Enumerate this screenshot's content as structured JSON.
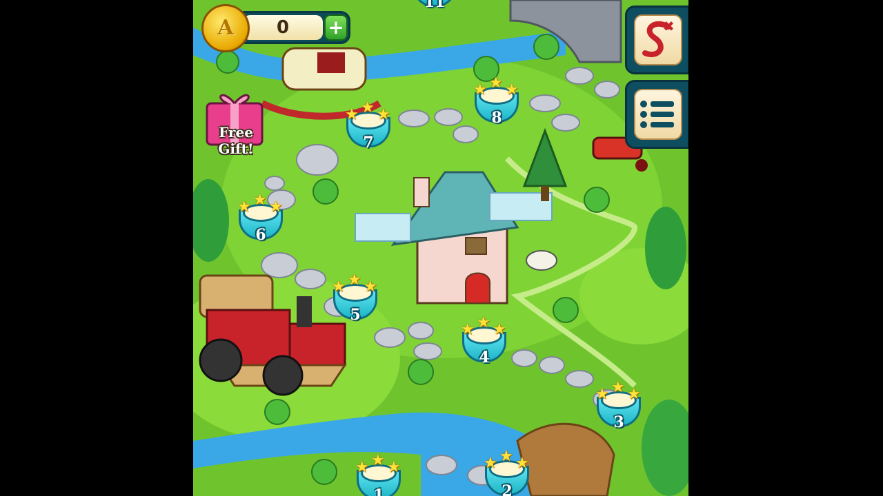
{
  "currency": {
    "letter": "A",
    "amount": "0",
    "add_label": "+"
  },
  "free_gift": {
    "line1": "Free",
    "line2": "Gift!"
  },
  "side_buttons": {
    "top_icon": "s-path-icon",
    "bottom_icon": "list-menu-icon"
  },
  "levels": [
    {
      "number": "1",
      "stars": 3
    },
    {
      "number": "2",
      "stars": 3
    },
    {
      "number": "3",
      "stars": 3
    },
    {
      "number": "4",
      "stars": 3
    },
    {
      "number": "5",
      "stars": 3
    },
    {
      "number": "6",
      "stars": 3
    },
    {
      "number": "7",
      "stars": 3
    },
    {
      "number": "8",
      "stars": 3
    },
    {
      "number": "11",
      "stars": 0
    }
  ],
  "colors": {
    "grass": "#6fc42e",
    "river": "#3aa7e6",
    "node": "#1db6c7",
    "star": "#ffe23a"
  }
}
